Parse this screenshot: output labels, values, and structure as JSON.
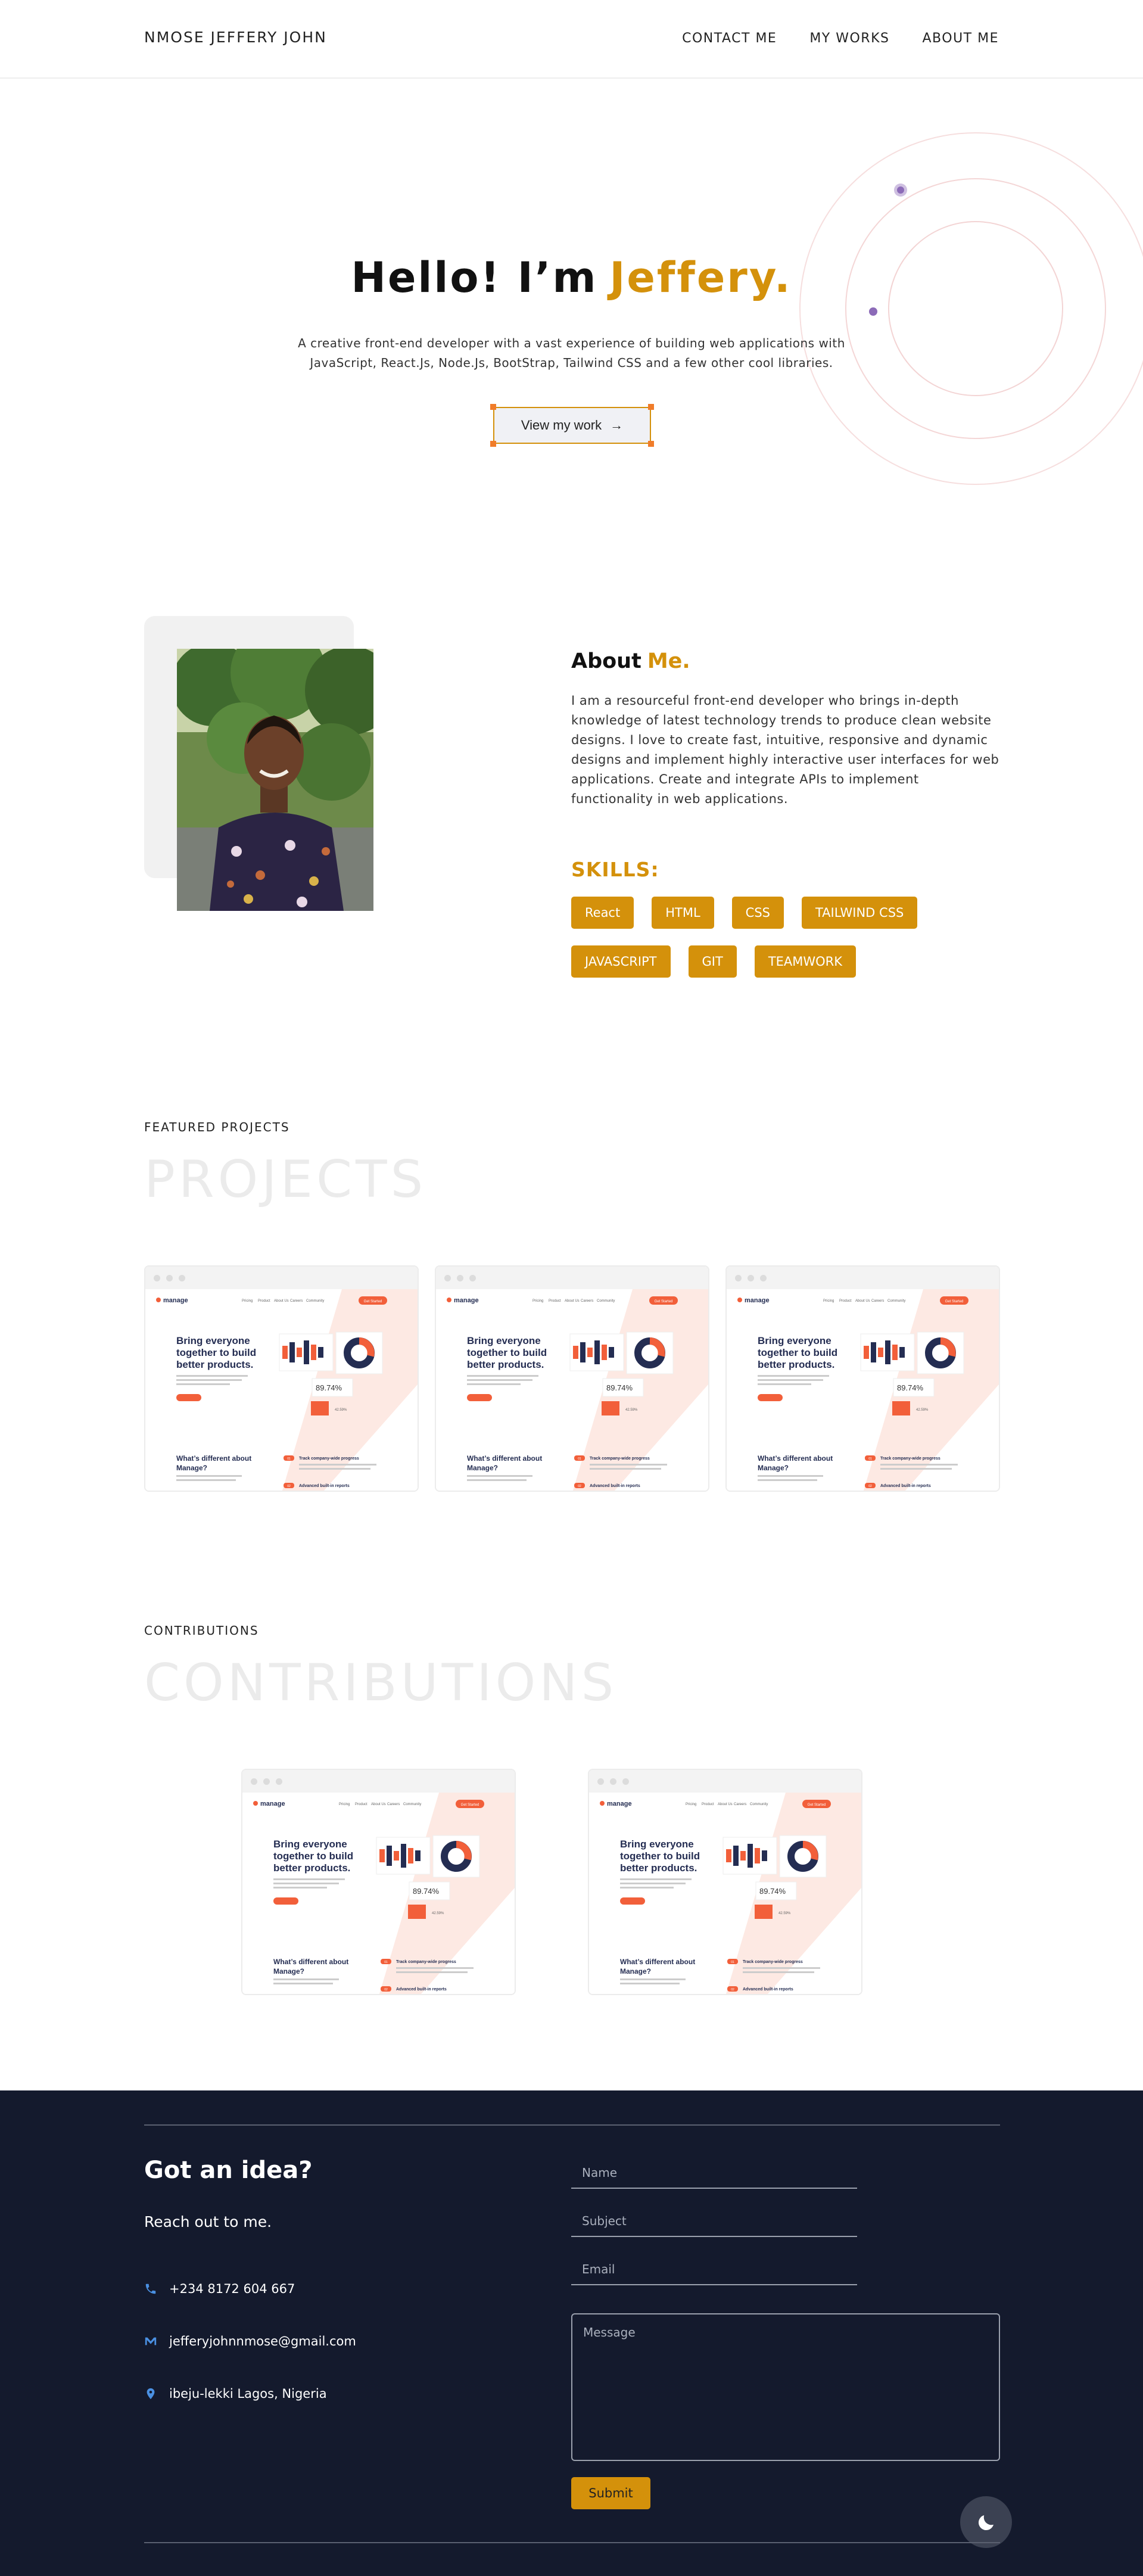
{
  "nav": {
    "brand": "NMOSE JEFFERY JOHN",
    "links": [
      "CONTACT ME",
      "MY WORKS",
      "ABOUT ME"
    ]
  },
  "hero": {
    "greeting": "Hello! I’m",
    "name": "Jeffery.",
    "description": "A creative front-end developer with a vast experience of building web applications with JavaScript, React.Js, Node.Js, BootStrap, Tailwind CSS and a few other cool libraries.",
    "button_label": "View my work",
    "button_arrow": "→"
  },
  "about": {
    "title": "About",
    "title_accent": "Me.",
    "text": "I am a resourceful front-end developer who brings in-depth knowledge of latest technology trends to produce clean website designs. I love to create fast, intuitive, responsive and dynamic designs and implement highly interactive user interfaces for web applications. Create and integrate APIs to implement functionality in web applications.",
    "skills_title": "SKILLS:",
    "skills": [
      "React",
      "HTML",
      "CSS",
      "TAILWIND CSS",
      "JAVASCRIPT",
      "GIT",
      "TEAMWORK"
    ]
  },
  "projects": {
    "label": "FEATURED PROJECTS",
    "big_title": "PROJECTS"
  },
  "contributions": {
    "label": "CONTRIBUTIONS",
    "big_title": "CONTRIBUTIONS"
  },
  "preview": {
    "logo": "manage",
    "nav": [
      "Pricing",
      "Product",
      "About Us",
      "Careers",
      "Community"
    ],
    "cta": "Get Started",
    "headline_1": "Bring everyone",
    "headline_2": "together to build",
    "headline_3": "better products.",
    "stat": "89.74%",
    "stat_small": "42.59%",
    "section_1": "What’s different about",
    "section_2": "Manage?",
    "feature_1": "Track company-wide progress",
    "feature_2": "Advanced built-in reports",
    "num_1": "01",
    "num_2": "02"
  },
  "footer": {
    "idea": "Got an idea?",
    "reach": "Reach out to me.",
    "phone": "+234 8172 604 667",
    "email": "jefferyjohnnmose@gmail.com",
    "location": "ibeju-lekki Lagos, Nigeria",
    "name_placeholder": "Name",
    "subject_placeholder": "Subject",
    "email_placeholder": "Email",
    "message_placeholder": "Message",
    "submit_label": "Submit"
  },
  "colors": {
    "accent": "#d4910b",
    "footer_bg": "#141a2d",
    "preview_orange": "#f25f3a",
    "preview_navy": "#242d52"
  },
  "icons": [
    "phone-icon",
    "mail-icon",
    "location-icon",
    "moon-icon",
    "arrow-right-icon"
  ]
}
